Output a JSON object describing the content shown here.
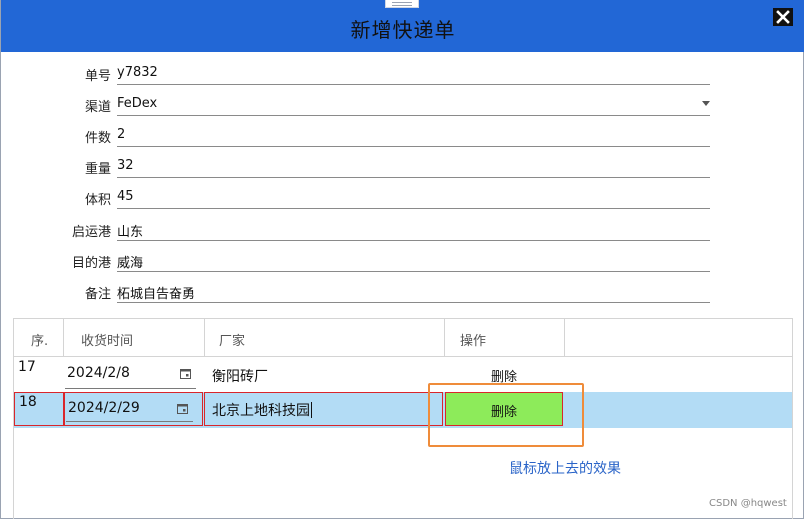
{
  "window": {
    "title": "新增快递单",
    "colors": {
      "titlebar": "#2267d6",
      "selected_row": "#b3dcf5",
      "hover_button": "#8deb5a",
      "highlight_border": "#d9262b",
      "annotation_box": "#ef8c3a"
    }
  },
  "form": {
    "fields": [
      {
        "label": "单号",
        "value": "y7832"
      },
      {
        "label": "渠道",
        "value": "FeDex"
      },
      {
        "label": "件数",
        "value": "2"
      },
      {
        "label": "重量",
        "value": "32"
      },
      {
        "label": "体积",
        "value": "45"
      },
      {
        "label": "启运港",
        "value": "山东"
      },
      {
        "label": "目的港",
        "value": "威海"
      },
      {
        "label": "备注",
        "value": "柘城自告奋勇"
      }
    ]
  },
  "grid": {
    "columns": [
      "序.",
      "收货时间",
      "厂家",
      "操作"
    ],
    "rows": [
      {
        "index": "17",
        "date": "2024/2/8",
        "factory": "衡阳砖厂",
        "action": "删除"
      },
      {
        "index": "18",
        "date": "2024/2/29",
        "factory": "北京上地科技园",
        "action": "删除"
      }
    ]
  },
  "annotation": "鼠标放上去的效果",
  "watermark": "CSDN @hqwest"
}
